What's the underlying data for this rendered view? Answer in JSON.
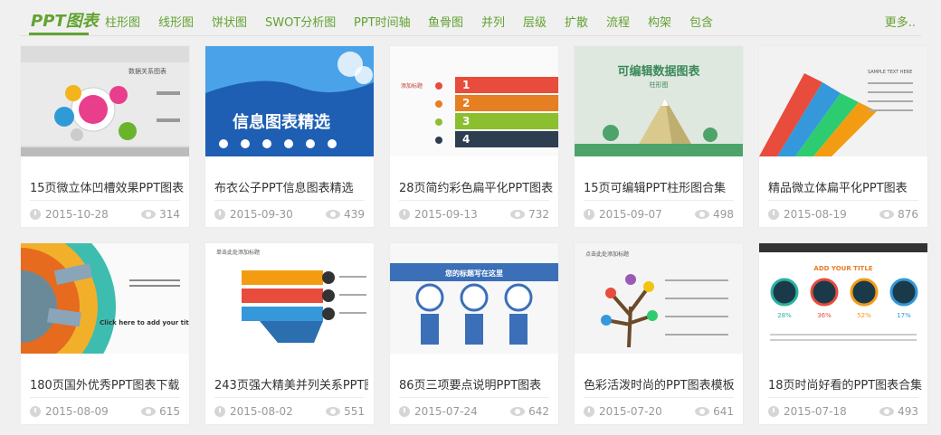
{
  "nav": {
    "brand": "PPT图表",
    "items": [
      "柱形图",
      "线形图",
      "饼状图",
      "SWOT分析图",
      "PPT时间轴",
      "鱼骨图",
      "并列",
      "层级",
      "扩散",
      "流程",
      "构架",
      "包含"
    ],
    "more": "更多.."
  },
  "cards": [
    {
      "title": "15页微立体凹槽效果PPT图表",
      "date": "2015-10-28",
      "views": "314",
      "thumb_text": "数据关系图表"
    },
    {
      "title": "布衣公子PPT信息图表精选",
      "date": "2015-09-30",
      "views": "439",
      "thumb_text": "信息图表精选"
    },
    {
      "title": "28页简约彩色扁平化PPT图表",
      "date": "2015-09-13",
      "views": "732",
      "thumb_text": "添加标题"
    },
    {
      "title": "15页可编辑PPT柱形图合集",
      "date": "2015-09-07",
      "views": "498",
      "thumb_text": "可编辑数据图表",
      "thumb_sub": "柱形图"
    },
    {
      "title": "精品微立体扁平化PPT图表",
      "date": "2015-08-19",
      "views": "876",
      "thumb_text": "SAMPLE TEXT HERE"
    },
    {
      "title": "180页国外优秀PPT图表下载",
      "date": "2015-08-09",
      "views": "615",
      "thumb_text": "Click here to add your title"
    },
    {
      "title": "243页强大精美并列关系PPT图",
      "date": "2015-08-02",
      "views": "551",
      "thumb_text": "单击此处添加标题"
    },
    {
      "title": "86页三项要点说明PPT图表",
      "date": "2015-07-24",
      "views": "642",
      "thumb_text": "您的标题写在这里"
    },
    {
      "title": "色彩活泼时尚的PPT图表模板",
      "date": "2015-07-20",
      "views": "641",
      "thumb_text": "点击此处添加标题"
    },
    {
      "title": "18页时尚好看的PPT图表合集",
      "date": "2015-07-18",
      "views": "493",
      "thumb_text": "ADD YOUR TITLE"
    }
  ],
  "icons": {
    "date": "clock-icon",
    "views": "eye-icon"
  },
  "colors": {
    "brand": "#62a231",
    "meta": "#999999"
  }
}
